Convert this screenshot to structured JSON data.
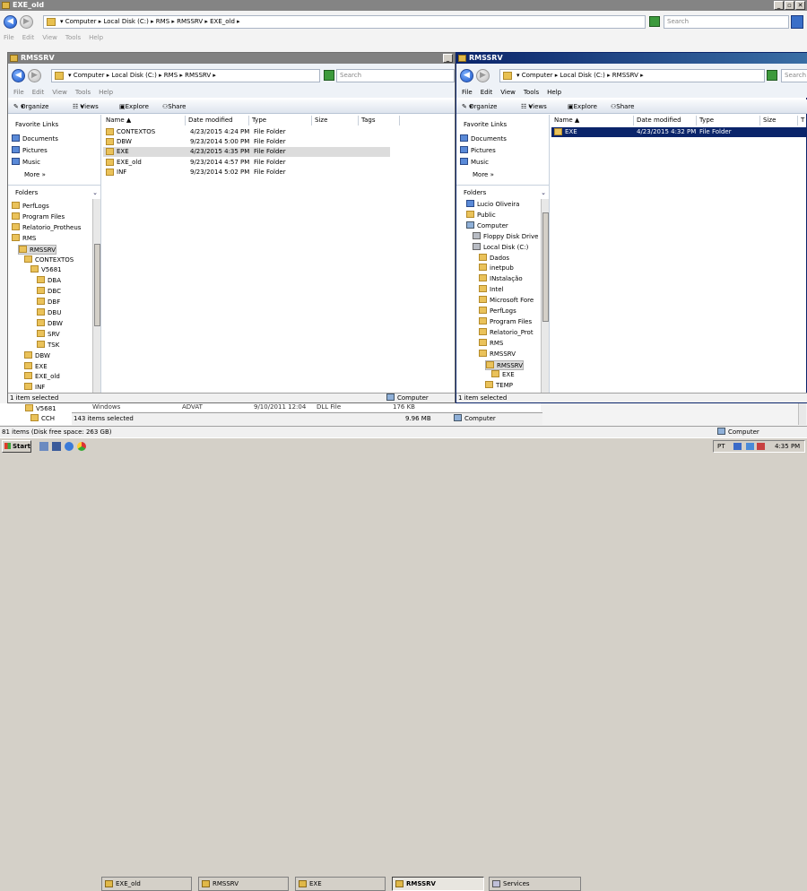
{
  "back_window": {
    "title": "EXE_old",
    "address": [
      "Computer",
      "Local Disk (C:)",
      "RMS",
      "RMSSRV",
      "EXE_old"
    ],
    "search_placeholder": "Search",
    "menu": [
      "File",
      "Edit",
      "View",
      "Tools",
      "Help"
    ],
    "left_tree": [
      {
        "label": "V5681"
      },
      {
        "label": "CCH"
      }
    ],
    "row_partial": {
      "name": "Windows",
      "file": "ADVAT",
      "date": "9/10/2011 12:04",
      "type": "DLL File",
      "size": "176 KB"
    },
    "status_left": "143 items selected",
    "status_size": "9.96 MB",
    "status_computer": "Computer",
    "bottom_status": "81 items (Disk free space: 263 GB)",
    "bottom_computer": "Computer"
  },
  "left_window": {
    "title": "RMSSRV",
    "address": [
      "Computer",
      "Local Disk (C:)",
      "RMS",
      "RMSSRV"
    ],
    "search_placeholder": "Search",
    "menu": [
      "File",
      "Edit",
      "View",
      "Tools",
      "Help"
    ],
    "toolbar": {
      "organize": "Organize",
      "views": "Views",
      "explore": "Explore",
      "share": "Share"
    },
    "favorites_title": "Favorite Links",
    "favorites": [
      "Documents",
      "Pictures",
      "Music"
    ],
    "more": "More",
    "folders_title": "Folders",
    "tree": [
      {
        "label": "PerfLogs",
        "indent": 0
      },
      {
        "label": "Program Files",
        "indent": 0
      },
      {
        "label": "Relatorio_Protheus",
        "indent": 0
      },
      {
        "label": "RMS",
        "indent": 0
      },
      {
        "label": "RMSSRV",
        "indent": 1,
        "selected": true
      },
      {
        "label": "CONTEXTOS",
        "indent": 2
      },
      {
        "label": "V5681",
        "indent": 3
      },
      {
        "label": "DBA",
        "indent": 4
      },
      {
        "label": "DBC",
        "indent": 4
      },
      {
        "label": "DBF",
        "indent": 4
      },
      {
        "label": "DBU",
        "indent": 4
      },
      {
        "label": "DBW",
        "indent": 4
      },
      {
        "label": "SRV",
        "indent": 4
      },
      {
        "label": "TSK",
        "indent": 4
      },
      {
        "label": "DBW",
        "indent": 2
      },
      {
        "label": "EXE",
        "indent": 2
      },
      {
        "label": "EXE_old",
        "indent": 2
      },
      {
        "label": "INF",
        "indent": 2
      }
    ],
    "columns": [
      "Name",
      "Date modified",
      "Type",
      "Size",
      "Tags"
    ],
    "files": [
      {
        "name": "CONTEXTOS",
        "date": "4/23/2015 4:24 PM",
        "type": "File Folder"
      },
      {
        "name": "DBW",
        "date": "9/23/2014 5:00 PM",
        "type": "File Folder"
      },
      {
        "name": "EXE",
        "date": "4/23/2015 4:35 PM",
        "type": "File Folder",
        "selected": true
      },
      {
        "name": "EXE_old",
        "date": "9/23/2014 4:57 PM",
        "type": "File Folder"
      },
      {
        "name": "INF",
        "date": "9/23/2014 5:02 PM",
        "type": "File Folder"
      }
    ],
    "status_left": "1 item selected",
    "status_computer": "Computer"
  },
  "right_window": {
    "title": "RMSSRV",
    "address": [
      "Computer",
      "Local Disk (C:)",
      "RMSSRV"
    ],
    "search_placeholder": "Search",
    "menu": [
      "File",
      "Edit",
      "View",
      "Tools",
      "Help"
    ],
    "toolbar": {
      "organize": "Organize",
      "views": "Views",
      "explore": "Explore",
      "share": "Share"
    },
    "favorites_title": "Favorite Links",
    "favorites": [
      "Documents",
      "Pictures",
      "Music"
    ],
    "more": "More",
    "folders_title": "Folders",
    "tree": [
      {
        "label": "Lucio Oliveira",
        "indent": 1,
        "icon": "blue"
      },
      {
        "label": "Public",
        "indent": 1
      },
      {
        "label": "Computer",
        "indent": 1,
        "icon": "comp"
      },
      {
        "label": "Floppy Disk Drive",
        "indent": 2,
        "icon": "drive"
      },
      {
        "label": "Local Disk (C:)",
        "indent": 2,
        "icon": "drive"
      },
      {
        "label": "Dados",
        "indent": 3
      },
      {
        "label": "inetpub",
        "indent": 3
      },
      {
        "label": "INstalação",
        "indent": 3
      },
      {
        "label": "Intel",
        "indent": 3
      },
      {
        "label": "Microsoft Fore",
        "indent": 3
      },
      {
        "label": "PerfLogs",
        "indent": 3
      },
      {
        "label": "Program Files",
        "indent": 3
      },
      {
        "label": "Relatorio_Prot",
        "indent": 3
      },
      {
        "label": "RMS",
        "indent": 3
      },
      {
        "label": "RMSSRV",
        "indent": 3
      },
      {
        "label": "RMSSRV",
        "indent": 4,
        "selected": true
      },
      {
        "label": "EXE",
        "indent": 5
      },
      {
        "label": "TEMP",
        "indent": 4
      }
    ],
    "columns": [
      "Name",
      "Date modified",
      "Type",
      "Size",
      "T"
    ],
    "files": [
      {
        "name": "EXE",
        "date": "4/23/2015 4:32 PM",
        "type": "File Folder",
        "selected": true
      }
    ],
    "status_left": "1 item selected"
  },
  "taskbar": {
    "start": "Start",
    "buttons": [
      {
        "label": "EXE_old"
      },
      {
        "label": "RMSSRV"
      },
      {
        "label": "EXE"
      },
      {
        "label": "RMSSRV",
        "active": true
      },
      {
        "label": "Services"
      }
    ],
    "lang": "PT",
    "time": "4:35 PM"
  },
  "colors": {
    "title_active": "#0a246a",
    "title_inactive": "#808080",
    "selection": "#0a246a",
    "hover": "#dcdcdc"
  }
}
